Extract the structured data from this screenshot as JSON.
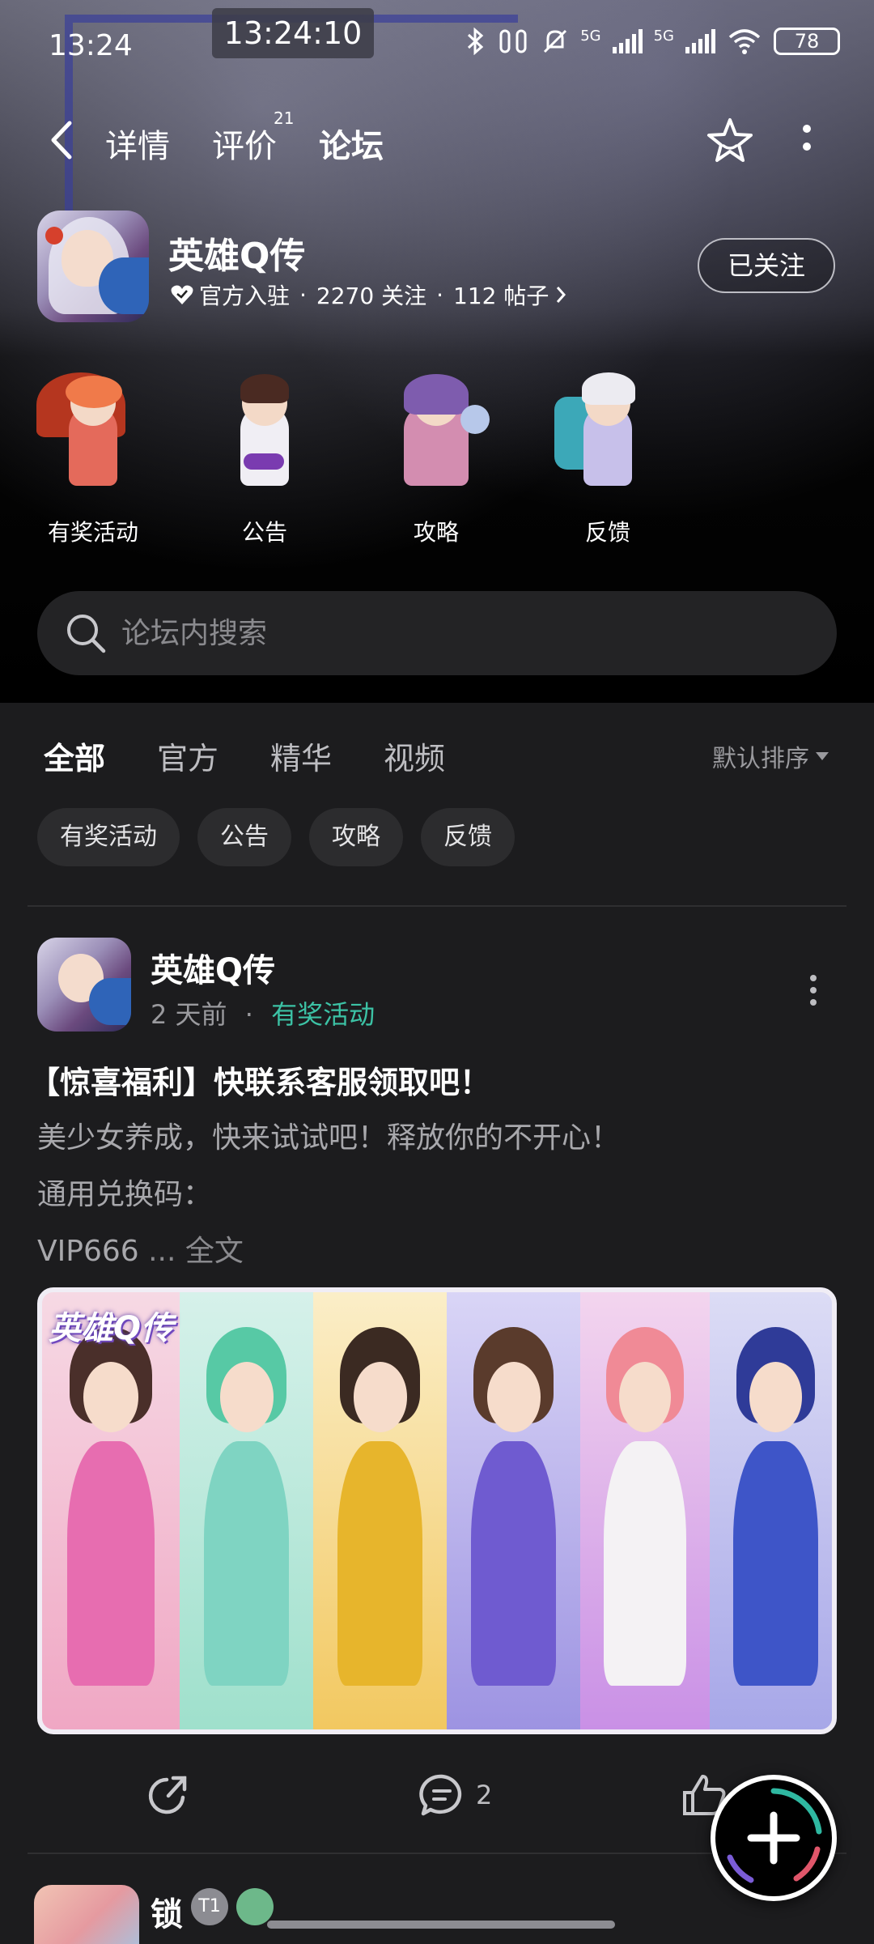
{
  "status_bar": {
    "time": "13:24",
    "clock_overlay": "13:24:10",
    "network_1": "5G",
    "network_2": "5G",
    "battery": "78"
  },
  "nav": {
    "tabs": [
      {
        "label": "详情"
      },
      {
        "label": "评价"
      },
      {
        "label": "论坛"
      }
    ],
    "review_count": "21",
    "active_tab": "论坛"
  },
  "game": {
    "title": "英雄Q传",
    "official": "官方入驻",
    "followers": "2270 关注",
    "posts": "112 帖子",
    "sep": "·",
    "follow_button": "已关注"
  },
  "categories": [
    {
      "label": "有奖活动"
    },
    {
      "label": "公告"
    },
    {
      "label": "攻略"
    },
    {
      "label": "反馈"
    }
  ],
  "search": {
    "placeholder": "论坛内搜索"
  },
  "filter_tabs": [
    {
      "label": "全部"
    },
    {
      "label": "官方"
    },
    {
      "label": "精华"
    },
    {
      "label": "视频"
    }
  ],
  "sort_label": "默认排序",
  "chips": [
    {
      "label": "有奖活动"
    },
    {
      "label": "公告"
    },
    {
      "label": "攻略"
    },
    {
      "label": "反馈"
    }
  ],
  "post": {
    "author": "英雄Q传",
    "time": "2 天前",
    "dot": "·",
    "tag": "有奖活动",
    "title": "【惊喜福利】快联系客服领取吧！",
    "line1": "美少女养成，快来试试吧！释放你的不开心！",
    "line2": "通用兑换码：",
    "line3": "VIP666",
    "ellipsis": " ... ",
    "full_text": "全文",
    "banner_logo": "英雄Q传",
    "comment_count": "2"
  },
  "next_post": {
    "author": "锁",
    "level": "T1"
  },
  "colors": {
    "accent": "#2fb8a1",
    "tag": "#3cc2a5",
    "background": "#1c1c1e"
  }
}
